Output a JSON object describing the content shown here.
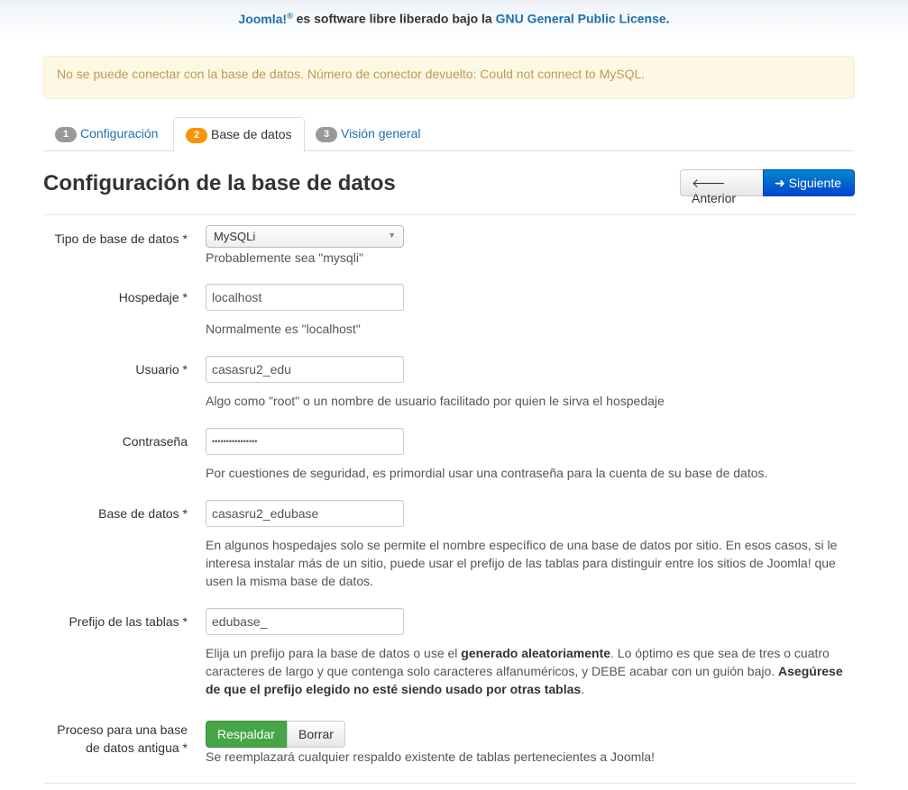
{
  "header": {
    "brand": "Joomla!",
    "brand_reg": "®",
    "text": " es software libre liberado bajo la ",
    "license_link": "GNU General Public License",
    "end": "."
  },
  "alert": {
    "message": "No se puede conectar con la base de datos. Número de conector devuelto: Could not connect to MySQL."
  },
  "tabs": [
    {
      "num": "1",
      "label": "Configuración"
    },
    {
      "num": "2",
      "label": "Base de datos"
    },
    {
      "num": "3",
      "label": "Visión general"
    }
  ],
  "page": {
    "title": "Configuración de la base de datos",
    "prev_label": "Anterior",
    "next_label": "Siguiente"
  },
  "form": {
    "db_type": {
      "label": "Tipo de base de datos *",
      "value": "MySQLi",
      "help": "Probablemente sea \"mysqli\""
    },
    "host": {
      "label": "Hospedaje *",
      "value": "localhost",
      "help": "Normalmente es \"localhost\""
    },
    "user": {
      "label": "Usuario *",
      "value": "casasru2_edu",
      "help": "Algo como \"root\" o un nombre de usuario facilitado por quien le sirva el hospedaje"
    },
    "password": {
      "label": "Contraseña",
      "value": "••••••••••••••••",
      "help": "Por cuestiones de seguridad, es primordial usar una contraseña para la cuenta de su base de datos."
    },
    "database": {
      "label": "Base de datos *",
      "value": "casasru2_edubase",
      "help": "En algunos hospedajes solo se permite el nombre específico de una base de datos por sitio. En esos casos, si le interesa instalar más de un sitio, puede usar el prefijo de las tablas para distinguir entre los sitios de Joomla! que usen la misma base de datos."
    },
    "prefix": {
      "label": "Prefijo de las tablas *",
      "value": "edubase_",
      "help_1": "Elija un prefijo para la base de datos o use el ",
      "help_bold_1": "generado aleatoriamente",
      "help_2": ". Lo óptimo es que sea de tres o cuatro caracteres de largo y que contenga solo caracteres alfanuméricos, y DEBE acabar con un guión bajo. ",
      "help_bold_2": "Asegúrese de que el prefijo elegido no esté siendo usado por otras tablas",
      "help_3": "."
    },
    "old_db": {
      "label_1": "Proceso para una base",
      "label_2": "de datos antigua *",
      "option_on": "Respaldar",
      "option_off": "Borrar",
      "help": "Se reemplazará cualquier respaldo existente de tablas pertenecientes a Joomla!"
    }
  },
  "colors": {
    "link": "#1f6fae",
    "alert_bg": "#fcf8e3",
    "alert_text": "#c09853",
    "primary": "#0044cc",
    "success": "#46a546",
    "active_badge": "#f89406"
  }
}
